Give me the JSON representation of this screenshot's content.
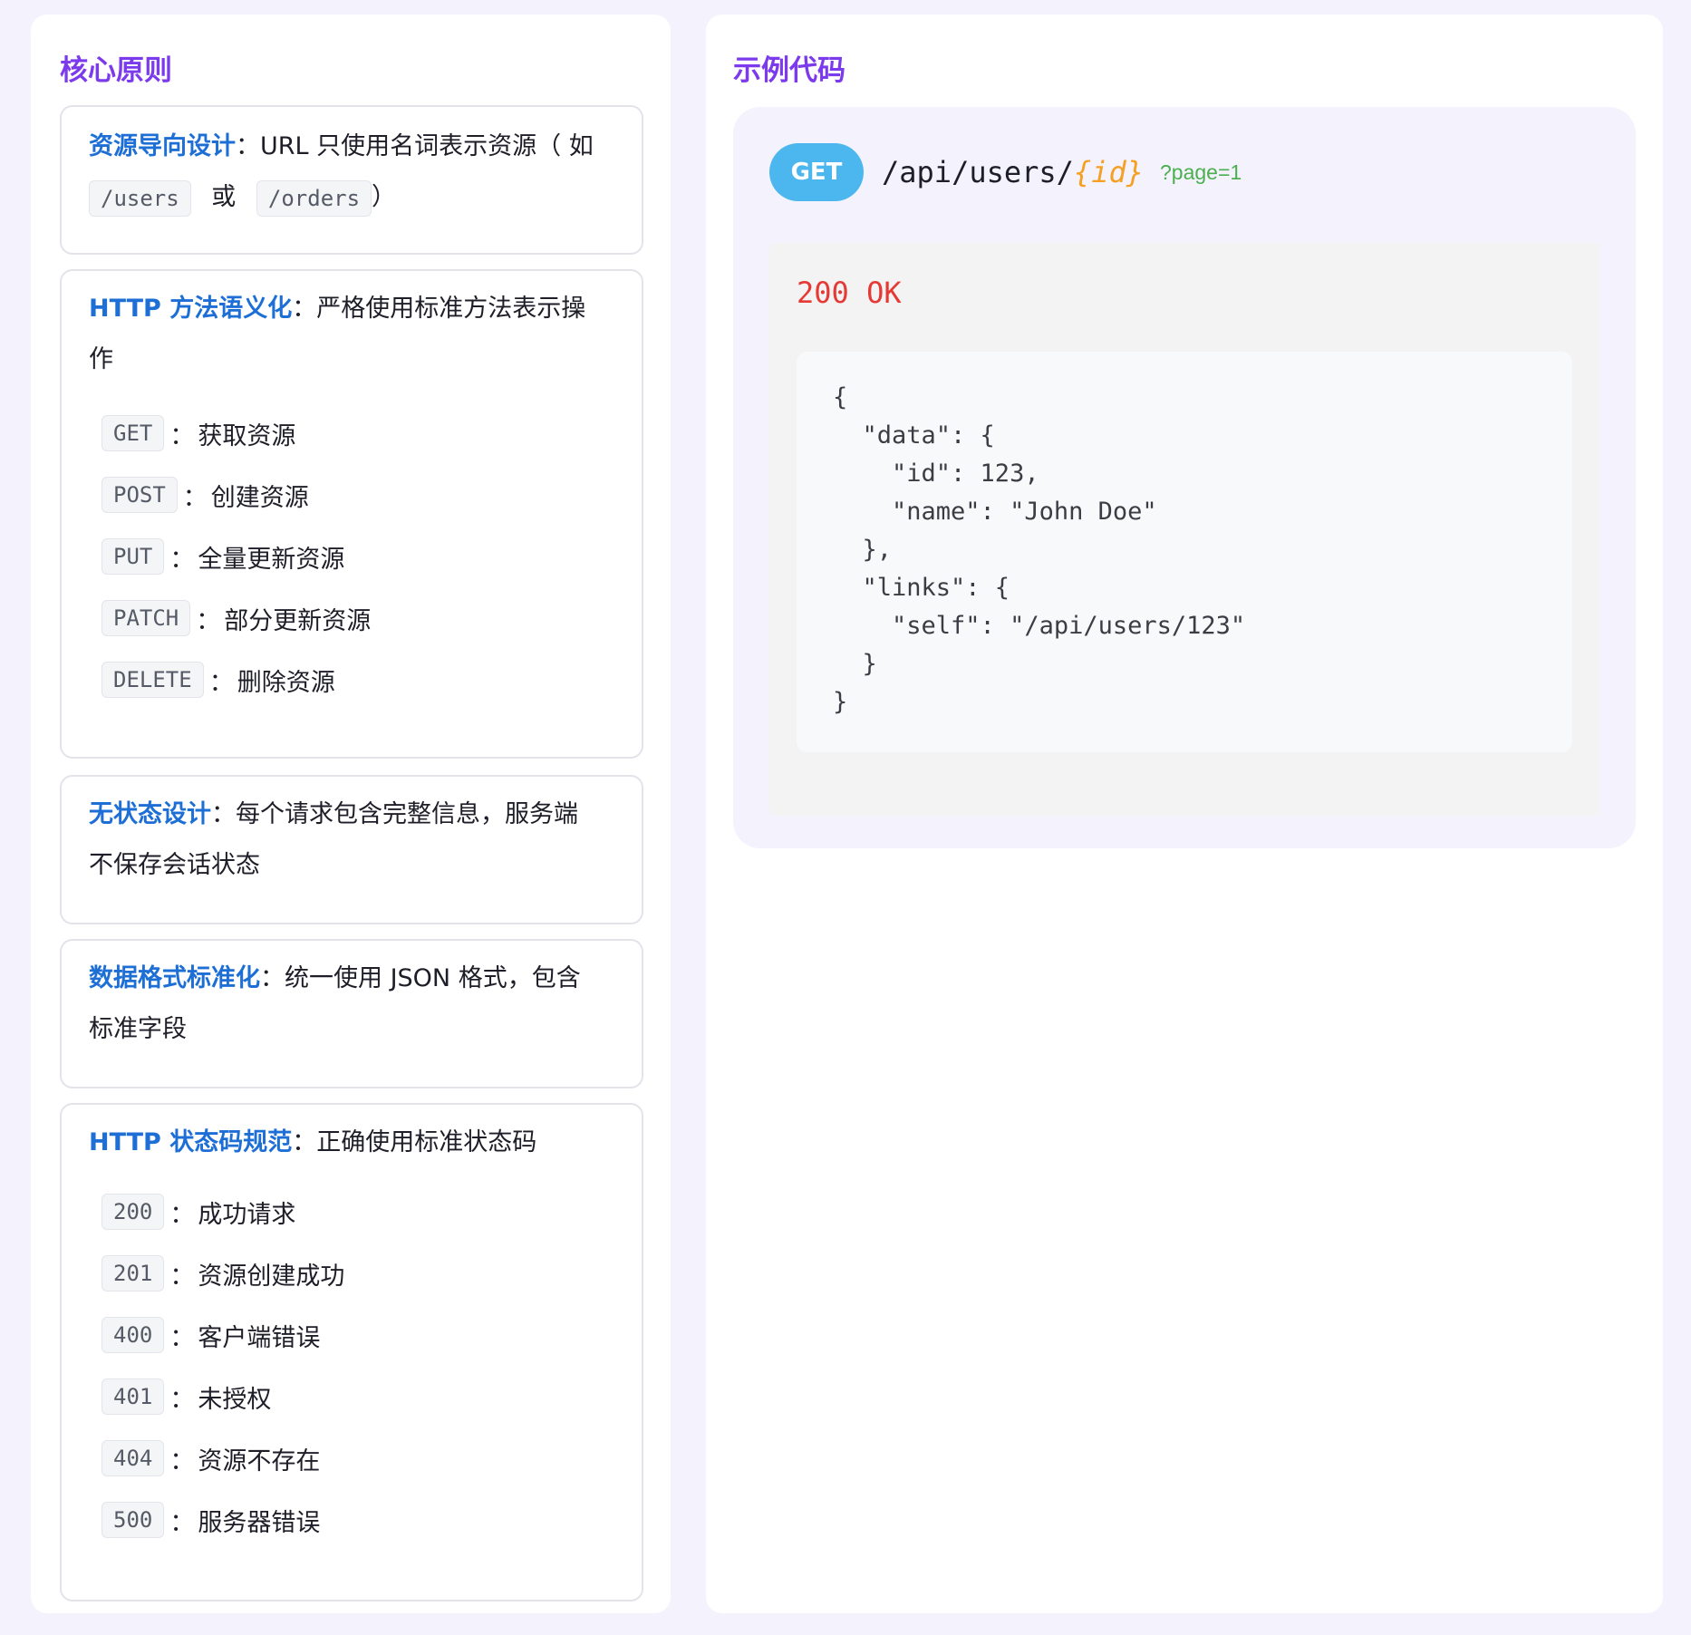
{
  "left": {
    "title": "核心原则",
    "card1": {
      "term": "资源导向设计",
      "text_before": "：URL 只使用名词表示资源（ 如",
      "chip1": "/users",
      "or_word": "或",
      "chip2": "/orders",
      "close": "）"
    },
    "card2": {
      "term": "HTTP 方法语义化",
      "text_line1": "：严格使用标准方法表示操",
      "text_line2": "作",
      "items": [
        {
          "code": "GET",
          "desc": "获取资源"
        },
        {
          "code": "POST",
          "desc": "创建资源"
        },
        {
          "code": "PUT",
          "desc": "全量更新资源"
        },
        {
          "code": "PATCH",
          "desc": "部分更新资源"
        },
        {
          "code": "DELETE",
          "desc": "删除资源"
        }
      ]
    },
    "card3": {
      "term": "无状态设计",
      "text_line1": "：每个请求包含完整信息，服务端",
      "text_line2": "不保存会话状态"
    },
    "card4": {
      "term": "数据格式标准化",
      "text_line1": "：统一使用 JSON 格式，包含",
      "text_line2": "标准字段"
    },
    "card5": {
      "term": "HTTP 状态码规范",
      "text": "：正确使用标准状态码",
      "items": [
        {
          "code": "200",
          "desc": "成功请求"
        },
        {
          "code": "201",
          "desc": "资源创建成功"
        },
        {
          "code": "400",
          "desc": "客户端错误"
        },
        {
          "code": "401",
          "desc": "未授权"
        },
        {
          "code": "404",
          "desc": "资源不存在"
        },
        {
          "code": "500",
          "desc": "服务器错误"
        }
      ]
    },
    "colon": "："
  },
  "right": {
    "title": "示例代码",
    "method": "GET",
    "url_path": "/api/users/",
    "url_param": "{id}",
    "url_query": "?page=1",
    "status": "200 OK",
    "body_json": "{\n  \"data\": {\n    \"id\": 123,\n    \"name\": \"John Doe\"\n  },\n  \"links\": {\n    \"self\": \"/api/users/123\"\n  }\n}"
  },
  "colors": {
    "page_bg": "#f4f3fd",
    "title_purple": "#7c3aed",
    "term_blue": "#1d6fd6",
    "method_badge": "#4cb6ef",
    "param_orange": "#f5a023",
    "query_green": "#4caf50",
    "status_red": "#e53935"
  }
}
